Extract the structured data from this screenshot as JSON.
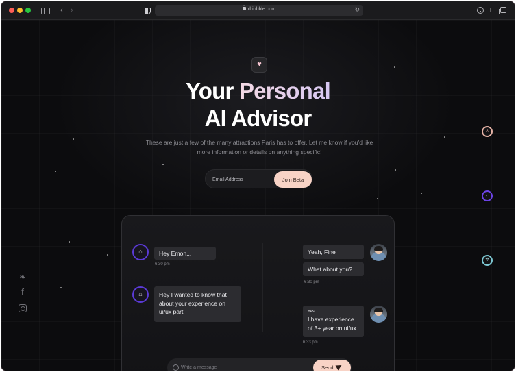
{
  "browser": {
    "url": "dribbble.com",
    "icons": [
      "sidebar-icon",
      "back-icon",
      "forward-icon",
      "shield-icon",
      "lock-icon",
      "reload-icon",
      "download-icon",
      "plus-icon",
      "tabs-icon"
    ]
  },
  "hero": {
    "badge_icon": "♥",
    "title_part1": "Your ",
    "title_accent": "Personal",
    "title_line2": "AI Advisor",
    "subtitle": "These are just a few of the many attractions Paris has to offer. Let me know if you'd like more information or details on anything specific!",
    "email_placeholder": "Email Address",
    "join_label": "Join Beta"
  },
  "timeline": {
    "step1_icon": "♙",
    "step2_icon": "◐",
    "step3_icon": "✲"
  },
  "social": {
    "twitter_icon": "🐦",
    "facebook_icon": "f"
  },
  "chat": {
    "bot_icon": "⌂",
    "messages": {
      "m1": "Hey Emon...",
      "m1_time": "6:30 pm",
      "m2": "Hey I wanted to know that about your experience on ui/ux part.",
      "r1": "Yeah, Fine",
      "r2": "What about you?",
      "r_time": "6:30 pm",
      "r3_prefix": "Yes,",
      "r3": "I have experience of 3+ year on ui/ux",
      "r3_time": "6:33 pm"
    },
    "composer_placeholder": "Write a message",
    "send_label": "Send"
  },
  "colors": {
    "accent_peach": "#f8d3c6",
    "accent_purple": "#5b3ad6",
    "accent_teal": "#7dc8d3"
  }
}
